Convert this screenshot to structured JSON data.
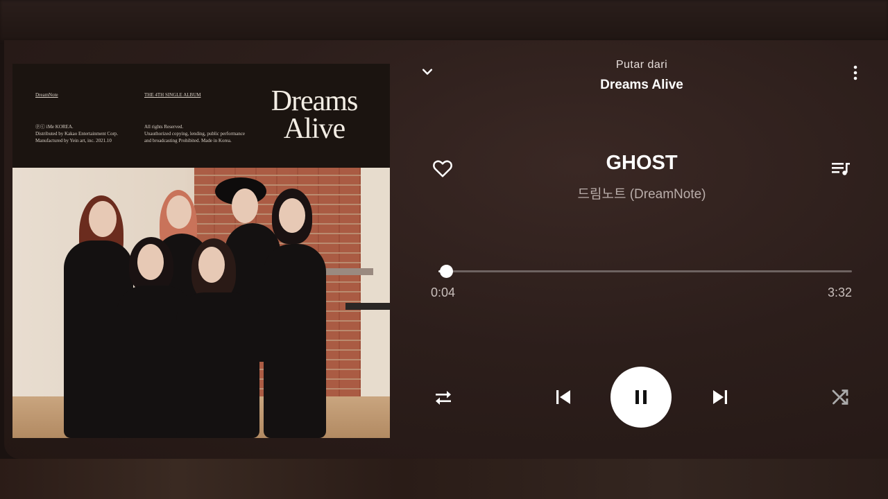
{
  "header": {
    "source_label": "Putar dari",
    "source_name": "Dreams Alive"
  },
  "album_art": {
    "brand": "DreamNote",
    "single_label": "THE 4TH SINGLE ALBUM",
    "title_line1": "Dreams",
    "title_line2": "Alive",
    "credits_left": "ⓟⓒ iMe KOREA.\nDistributed by Kakao Entertainment Corp.\nManufactured by Yein art, inc. 2021.10",
    "credits_right": "All rights Reserved.\nUnauthorized copying, lending, public performance\nand broadcasting Prohibited. Made in Korea."
  },
  "track": {
    "title": "GHOST",
    "artist": "드림노트 (DreamNote)",
    "elapsed": "0:04",
    "duration": "3:32",
    "progress_fraction": 0.019
  },
  "icons": {
    "collapse": "chevron-down-icon",
    "menu": "more-vert-icon",
    "like": "heart-outline-icon",
    "queue": "queue-music-icon",
    "repeat": "repeat-icon",
    "previous": "skip-previous-icon",
    "pause": "pause-icon",
    "next": "skip-next-icon",
    "shuffle": "shuffle-icon"
  },
  "colors": {
    "background": "#2c1e1b",
    "accent": "#ffffff",
    "secondary_text": "#b9adaa"
  }
}
